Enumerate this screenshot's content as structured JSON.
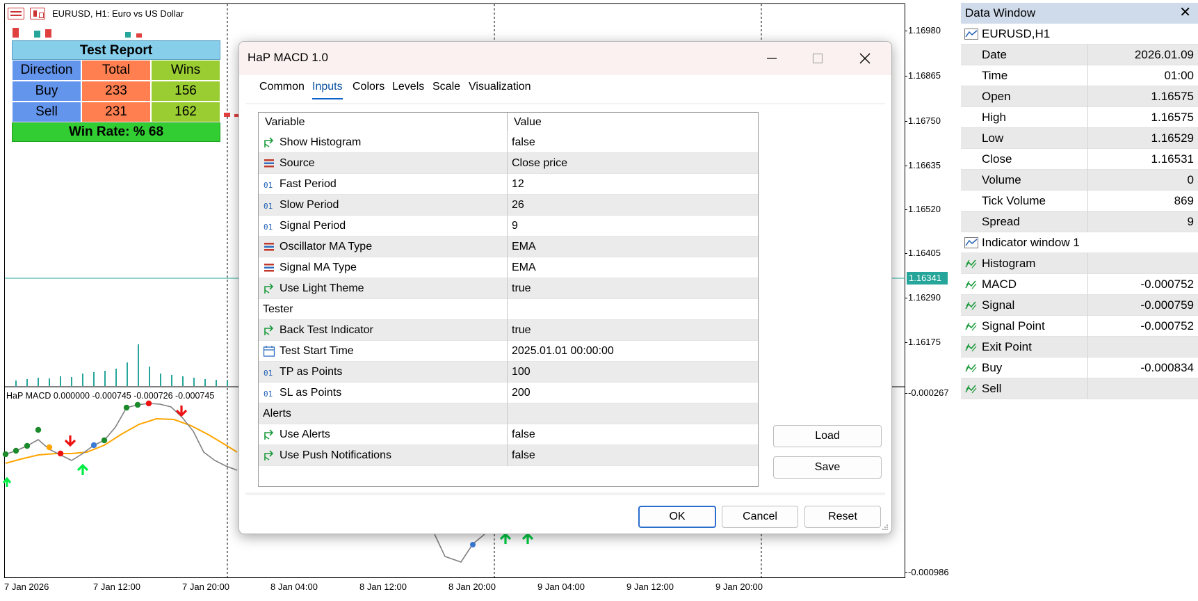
{
  "chart": {
    "title": "EURUSD, H1:  Euro vs US Dollar",
    "price_labels": [
      "1.16980",
      "1.16865",
      "1.16750",
      "1.16635",
      "1.16520",
      "1.16405",
      "1.16290",
      "1.16175"
    ],
    "current_price": "1.16341",
    "sub_price_labels": [
      "-0.000267",
      "-0.000986"
    ],
    "time_labels": [
      "7 Jan 2026",
      "7 Jan 12:00",
      "7 Jan 20:00",
      "8 Jan 04:00",
      "8 Jan 12:00",
      "8 Jan 20:00",
      "9 Jan 04:00",
      "9 Jan 12:00",
      "9 Jan 20:00"
    ],
    "indicator_title": "HaP MACD 0.000000 -0.000745 -0.000726 -0.000745"
  },
  "report": {
    "title": "Test Report",
    "headers": [
      "Direction",
      "Total",
      "Wins"
    ],
    "rows": [
      {
        "direction": "Buy",
        "total": "233",
        "wins": "156"
      },
      {
        "direction": "Sell",
        "total": "231",
        "wins": "162"
      }
    ],
    "footer": "Win Rate: %  68"
  },
  "data_window": {
    "title": "Data Window",
    "symbol": "EURUSD,H1",
    "rows": [
      {
        "name": "Date",
        "value": "2026.01.09"
      },
      {
        "name": "Time",
        "value": "01:00"
      },
      {
        "name": "Open",
        "value": "1.16575"
      },
      {
        "name": "High",
        "value": "1.16575"
      },
      {
        "name": "Low",
        "value": "1.16529"
      },
      {
        "name": "Close",
        "value": "1.16531"
      },
      {
        "name": "Volume",
        "value": "0"
      },
      {
        "name": "Tick Volume",
        "value": "869"
      },
      {
        "name": "Spread",
        "value": "9"
      }
    ],
    "indicator_window": "Indicator window 1",
    "indicator_rows": [
      {
        "name": "Histogram",
        "value": ""
      },
      {
        "name": "MACD",
        "value": "-0.000752"
      },
      {
        "name": "Signal",
        "value": "-0.000759"
      },
      {
        "name": "Signal Point",
        "value": "-0.000752"
      },
      {
        "name": "Exit Point",
        "value": ""
      },
      {
        "name": "Buy",
        "value": "-0.000834"
      },
      {
        "name": "Sell",
        "value": ""
      }
    ]
  },
  "dialog": {
    "title": "HaP MACD 1.0",
    "tabs": [
      "Common",
      "Inputs",
      "Colors",
      "Levels",
      "Scale",
      "Visualization"
    ],
    "active_tab": "Inputs",
    "columns": {
      "variable": "Variable",
      "value": "Value"
    },
    "params": [
      {
        "icon": "bool",
        "name": "Show Histogram",
        "value": "false"
      },
      {
        "icon": "enum",
        "name": "Source",
        "value": "Close price"
      },
      {
        "icon": "int",
        "name": "Fast Period",
        "value": "12"
      },
      {
        "icon": "int",
        "name": "Slow Period",
        "value": "26"
      },
      {
        "icon": "int",
        "name": "Signal Period",
        "value": "9"
      },
      {
        "icon": "enum",
        "name": "Oscillator MA Type",
        "value": "EMA"
      },
      {
        "icon": "enum",
        "name": "Signal MA Type",
        "value": "EMA"
      },
      {
        "icon": "bool",
        "name": "Use Light Theme",
        "value": "true"
      },
      {
        "icon": "group",
        "name": "Tester",
        "value": ""
      },
      {
        "icon": "bool",
        "name": "Back Test Indicator",
        "value": "true"
      },
      {
        "icon": "date",
        "name": "Test Start Time",
        "value": "2025.01.01 00:00:00"
      },
      {
        "icon": "int",
        "name": "TP as Points",
        "value": "100"
      },
      {
        "icon": "int",
        "name": "SL as Points",
        "value": "200"
      },
      {
        "icon": "group",
        "name": "Alerts",
        "value": ""
      },
      {
        "icon": "bool",
        "name": "Use Alerts",
        "value": "false"
      },
      {
        "icon": "bool",
        "name": "Use Push Notifications",
        "value": "false"
      }
    ],
    "buttons": {
      "load": "Load",
      "save": "Save",
      "ok": "OK",
      "cancel": "Cancel",
      "reset": "Reset"
    }
  },
  "colors": {
    "macd_line": "#808080",
    "signal_line": "#ffa500",
    "buy_arrow": "#00cc44",
    "sell_arrow": "#ee1111",
    "histogram": "#26a69a",
    "accent": "#0a64c8"
  }
}
